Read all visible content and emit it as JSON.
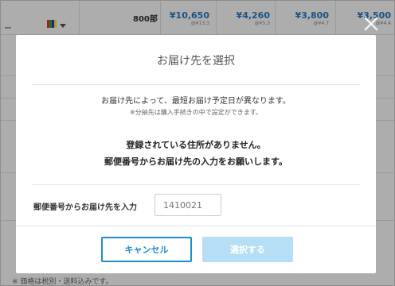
{
  "background": {
    "qty_label": "800部",
    "prices": [
      {
        "value": "¥10,650",
        "unit": "@¥13.3"
      },
      {
        "value": "¥4,260",
        "unit": "@¥5.3"
      },
      {
        "value": "¥3,800",
        "unit": "@¥4.7"
      },
      {
        "value": "¥3,500",
        "unit": "@¥4.4"
      }
    ],
    "footer_note": "※ 価格は税別・送料込みです。"
  },
  "modal": {
    "title": "お届け先を選択",
    "message_line1": "お届け先によって、最短お届け予定日が異なります。",
    "message_line2": "※分納先は購入手続きの中で設定ができます。",
    "notice_line1": "登録されている住所がありません。",
    "notice_line2": "郵便番号からお届け先の入力をお願いします。",
    "zip_label": "郵便番号からお届け先を入力",
    "zip_placeholder": "1410021",
    "cancel_label": "キャンセル",
    "select_label": "選択する"
  },
  "colors": {
    "accent": "#1e8ec8",
    "disabled_button": "#b6def4",
    "price": "#2a7ac2"
  }
}
